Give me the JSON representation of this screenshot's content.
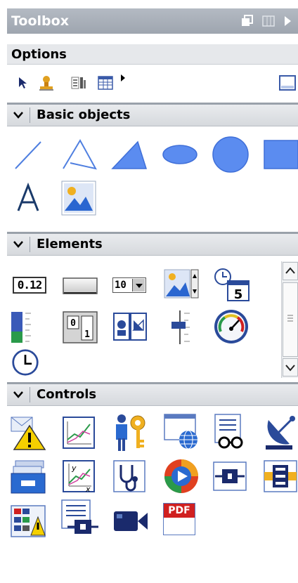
{
  "toolbox": {
    "title": "Toolbox"
  },
  "options": {
    "label": "Options"
  },
  "sections": {
    "basic_objects": {
      "label": "Basic objects"
    },
    "elements": {
      "label": "Elements"
    },
    "controls": {
      "label": "Controls"
    }
  },
  "elements": {
    "io_field_text": "0.12",
    "symbolic_io_text": "10",
    "date_time_text": "5"
  },
  "controls": {
    "pdf_text": "PDF"
  },
  "colors": {
    "header_bg": "#a8aeb7",
    "section_bg": "#e0e3e7",
    "accent_blue": "#4f7fe0",
    "shape_blue": "#5b8cf0"
  }
}
